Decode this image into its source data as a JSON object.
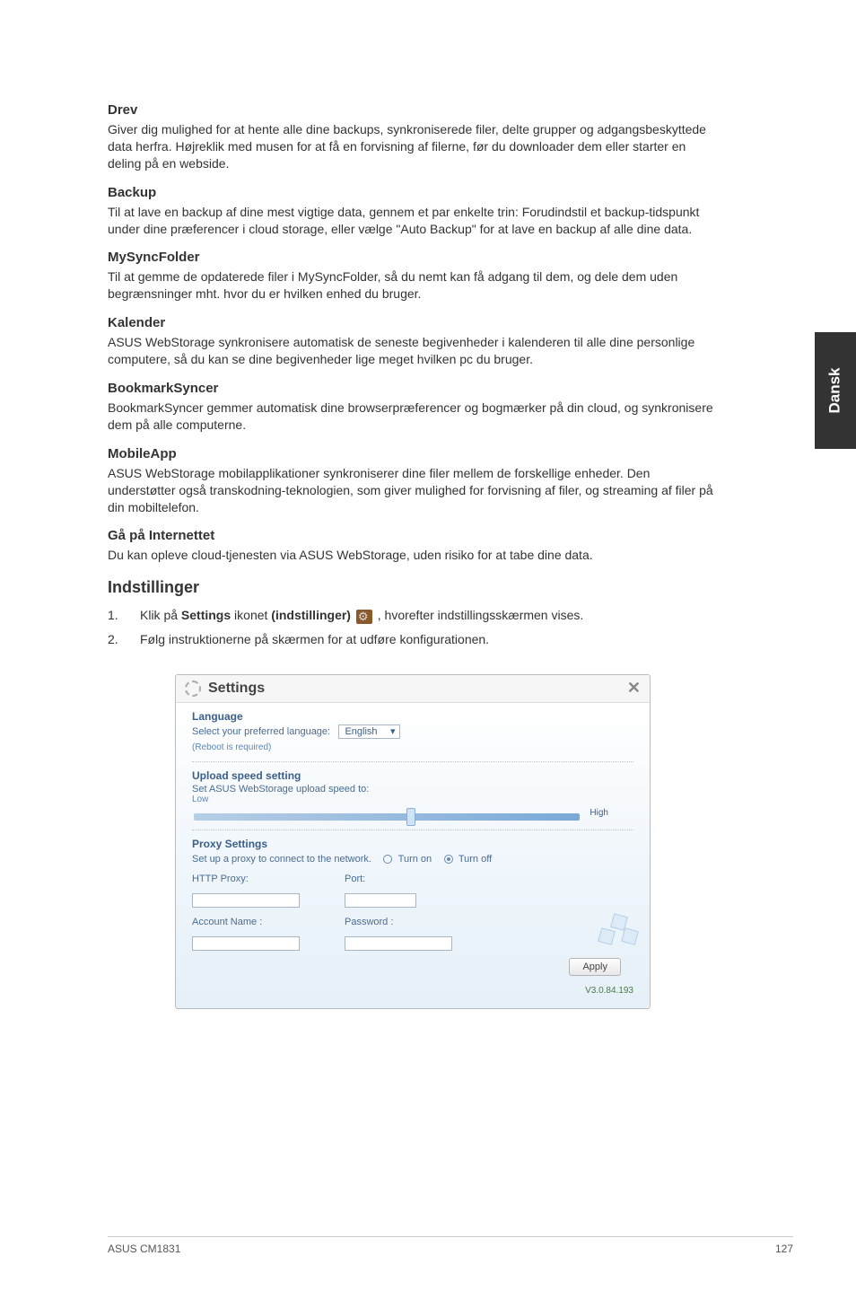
{
  "sideTab": "Dansk",
  "sections": {
    "drev": {
      "title": "Drev",
      "text": "Giver dig mulighed for at hente alle dine backups, synkroniserede filer, delte grupper og adgangsbeskyttede data herfra. Højreklik med musen for at få en forvisning af filerne, før du downloader dem eller starter en deling på en webside."
    },
    "backup": {
      "title": "Backup",
      "text": "Til at lave en backup af dine mest vigtige data, gennem et par enkelte trin: Forudindstil et backup-tidspunkt under dine præferencer i cloud storage, eller vælge \"Auto Backup\" for at lave en backup af alle dine data."
    },
    "mysync": {
      "title": "MySyncFolder",
      "text": "Til at gemme de opdaterede filer i MySyncFolder, så du nemt kan få adgang til dem, og dele dem uden begrænsninger mht. hvor du er hvilken enhed du bruger."
    },
    "kalender": {
      "title": "Kalender",
      "text": "ASUS WebStorage synkronisere automatisk de seneste begivenheder i kalenderen til alle dine personlige computere, så du kan se dine begivenheder lige meget hvilken pc du bruger."
    },
    "bookmark": {
      "title": "BookmarkSyncer",
      "text": "BookmarkSyncer gemmer automatisk dine browserpræferencer og bogmærker på din cloud, og synkronisere dem på alle computerne."
    },
    "mobile": {
      "title": "MobileApp",
      "text": "ASUS WebStorage mobilapplikationer synkroniserer dine filer mellem de forskellige enheder. Den understøtter også transkodning-teknologien, som giver mulighed for forvisning af filer, og streaming af filer på din mobiltelefon."
    },
    "net": {
      "title": "Gå på Internettet",
      "text": "Du kan opleve cloud-tjenesten via ASUS WebStorage, uden risiko for at tabe dine data."
    }
  },
  "indstillinger": {
    "heading": "Indstillinger",
    "step1_pre": "Klik på ",
    "step1_bold1": "Settings",
    "step1_mid": " ikonet ",
    "step1_bold2": "(indstillinger)",
    "step1_post": " , hvorefter indstillingsskærmen vises.",
    "step2": "Følg instruktionerne på skærmen for at udføre konfigurationen."
  },
  "dialog": {
    "title": "Settings",
    "language": {
      "heading": "Language",
      "label": "Select your preferred language:",
      "value": "English",
      "note": "(Reboot is required)"
    },
    "upload": {
      "heading": "Upload speed setting",
      "label": "Set ASUS WebStorage upload speed to:",
      "low": "Low",
      "high": "High"
    },
    "proxy": {
      "heading": "Proxy Settings",
      "label": "Set up a proxy to connect to the network.",
      "turnon": "Turn on",
      "turnoff": "Turn off",
      "httpProxy": "HTTP Proxy:",
      "port": "Port:",
      "account": "Account Name :",
      "password": "Password :"
    },
    "apply": "Apply",
    "version": "V3.0.84.193"
  },
  "footer": {
    "left": "ASUS CM1831",
    "right": "127"
  }
}
